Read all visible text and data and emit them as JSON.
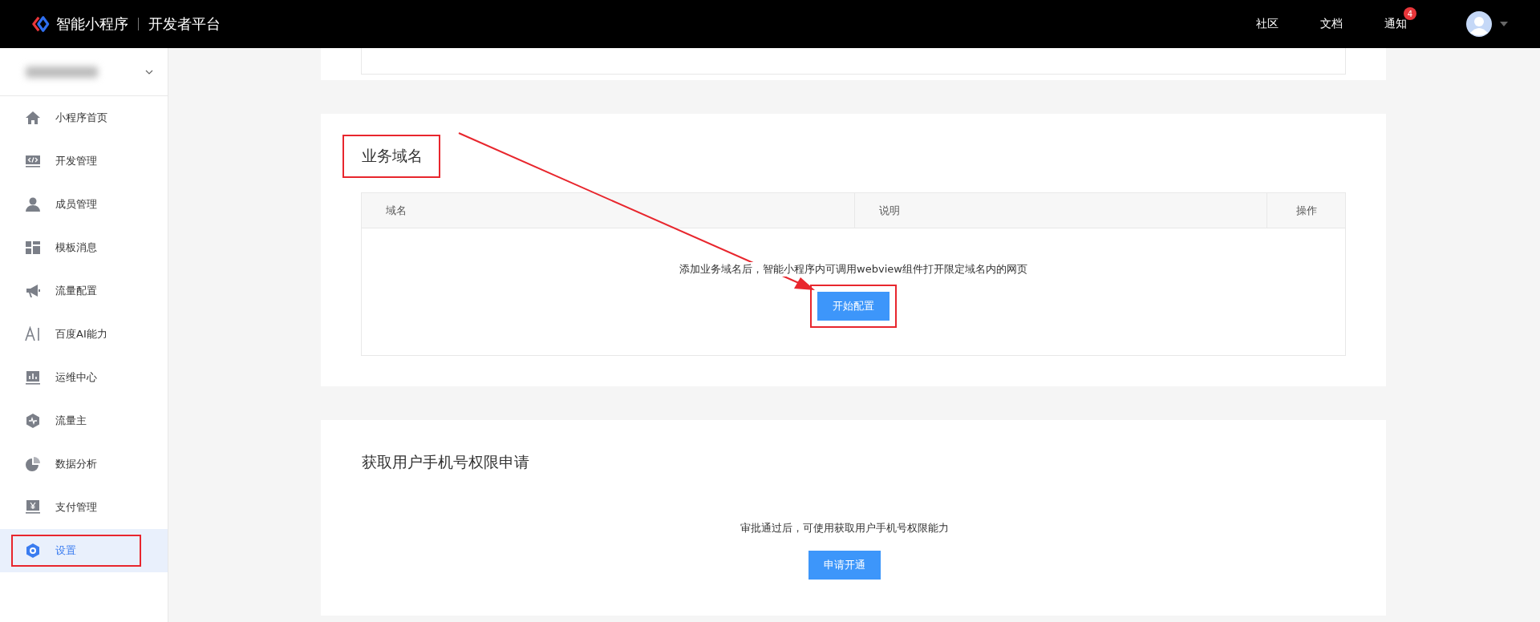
{
  "header": {
    "brand": "智能小程序",
    "platform": "开发者平台",
    "nav": [
      {
        "label": "社区"
      },
      {
        "label": "文档"
      },
      {
        "label": "通知",
        "badge": "4"
      }
    ]
  },
  "sidebar": {
    "items": [
      {
        "label": "小程序首页",
        "selected": false,
        "annotated": false
      },
      {
        "label": "开发管理",
        "selected": false,
        "annotated": false
      },
      {
        "label": "成员管理",
        "selected": false,
        "annotated": false
      },
      {
        "label": "模板消息",
        "selected": false,
        "annotated": false
      },
      {
        "label": "流量配置",
        "selected": false,
        "annotated": false
      },
      {
        "label": "百度AI能力",
        "selected": false,
        "annotated": false
      },
      {
        "label": "运维中心",
        "selected": false,
        "annotated": false
      },
      {
        "label": "流量主",
        "selected": false,
        "annotated": false
      },
      {
        "label": "数据分析",
        "selected": false,
        "annotated": false
      },
      {
        "label": "支付管理",
        "selected": false,
        "annotated": false
      },
      {
        "label": "设置",
        "selected": true,
        "annotated": true
      }
    ]
  },
  "sections": [
    {
      "kind": "table",
      "title": "业务域名",
      "title_annotated": true,
      "columns": [
        "域名",
        "说明",
        "操作"
      ],
      "empty_text": "添加业务域名后，智能小程序内可调用webview组件打开限定域名内的网页",
      "button": "开始配置",
      "button_annotated": true
    },
    {
      "kind": "plain",
      "title": "获取用户手机号权限申请",
      "title_annotated": false,
      "text": "审批通过后，可使用获取用户手机号权限能力",
      "button": "申请开通",
      "button_annotated": false
    }
  ]
}
